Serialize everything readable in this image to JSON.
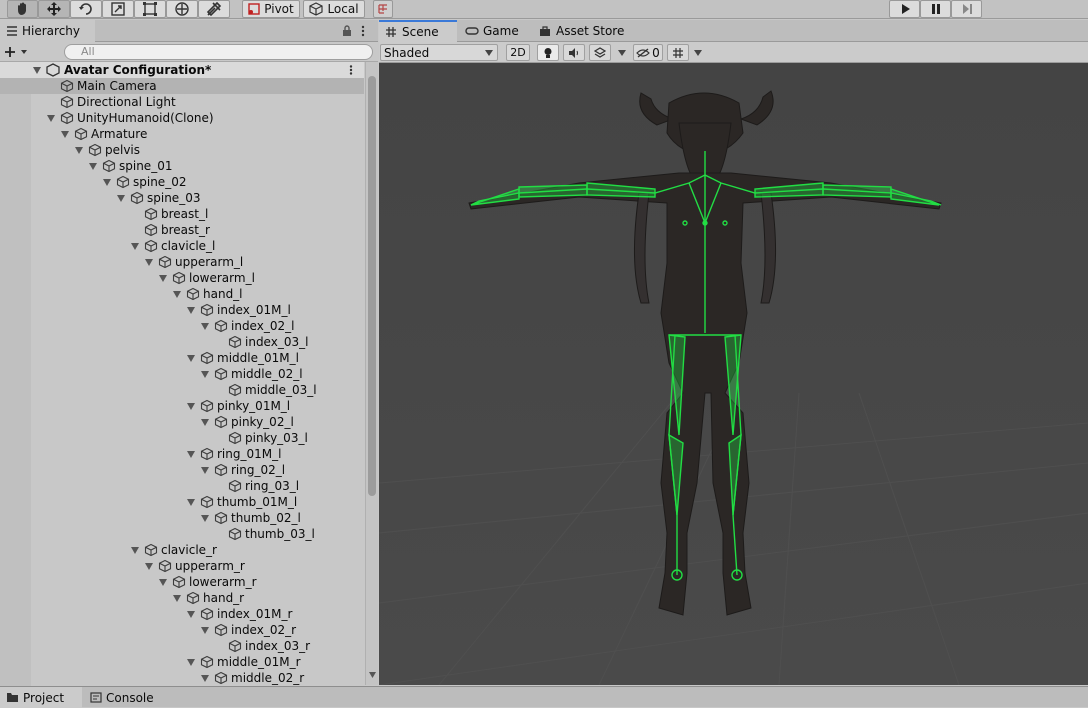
{
  "toolbar": {
    "tools": [
      {
        "name": "hand-tool",
        "active": true
      },
      {
        "name": "move-tool"
      },
      {
        "name": "rotate-tool"
      },
      {
        "name": "scale-tool"
      },
      {
        "name": "rect-tool"
      },
      {
        "name": "transform-tool"
      },
      {
        "name": "custom-tool"
      }
    ],
    "pivot_label": "Pivot",
    "local_label": "Local",
    "play_label": "Play",
    "pause_label": "Pause",
    "step_label": "Step"
  },
  "hierarchy": {
    "tab_label": "Hierarchy",
    "search_placeholder": "All",
    "scene_name": "Avatar Configuration*",
    "items": [
      {
        "label": "Main Camera"
      },
      {
        "label": "Directional Light"
      },
      {
        "label": "UnityHumanoid(Clone)"
      },
      {
        "label": "Armature"
      },
      {
        "label": "pelvis"
      },
      {
        "label": "spine_01"
      },
      {
        "label": "spine_02"
      },
      {
        "label": "spine_03"
      },
      {
        "label": "breast_l"
      },
      {
        "label": "breast_r"
      },
      {
        "label": "clavicle_l"
      },
      {
        "label": "upperarm_l"
      },
      {
        "label": "lowerarm_l"
      },
      {
        "label": "hand_l"
      },
      {
        "label": "index_01M_l"
      },
      {
        "label": "index_02_l"
      },
      {
        "label": "index_03_l"
      },
      {
        "label": "middle_01M_l"
      },
      {
        "label": "middle_02_l"
      },
      {
        "label": "middle_03_l"
      },
      {
        "label": "pinky_01M_l"
      },
      {
        "label": "pinky_02_l"
      },
      {
        "label": "pinky_03_l"
      },
      {
        "label": "ring_01M_l"
      },
      {
        "label": "ring_02_l"
      },
      {
        "label": "ring_03_l"
      },
      {
        "label": "thumb_01M_l"
      },
      {
        "label": "thumb_02_l"
      },
      {
        "label": "thumb_03_l"
      },
      {
        "label": "clavicle_r"
      },
      {
        "label": "upperarm_r"
      },
      {
        "label": "lowerarm_r"
      },
      {
        "label": "hand_r"
      },
      {
        "label": "index_01M_r"
      },
      {
        "label": "index_02_r"
      },
      {
        "label": "index_03_r"
      },
      {
        "label": "middle_01M_r"
      },
      {
        "label": "middle_02_r"
      }
    ]
  },
  "scene_view": {
    "tabs": [
      {
        "label": "Scene",
        "active": true
      },
      {
        "label": "Game"
      },
      {
        "label": "Asset Store"
      }
    ],
    "shading_mode": "Shaded",
    "mode_2d_label": "2D",
    "hidden_count": "0",
    "colors": {
      "bone": "#22dd44",
      "background": "#474747"
    }
  },
  "bottom": {
    "tabs": [
      {
        "label": "Project"
      },
      {
        "label": "Console"
      }
    ]
  }
}
